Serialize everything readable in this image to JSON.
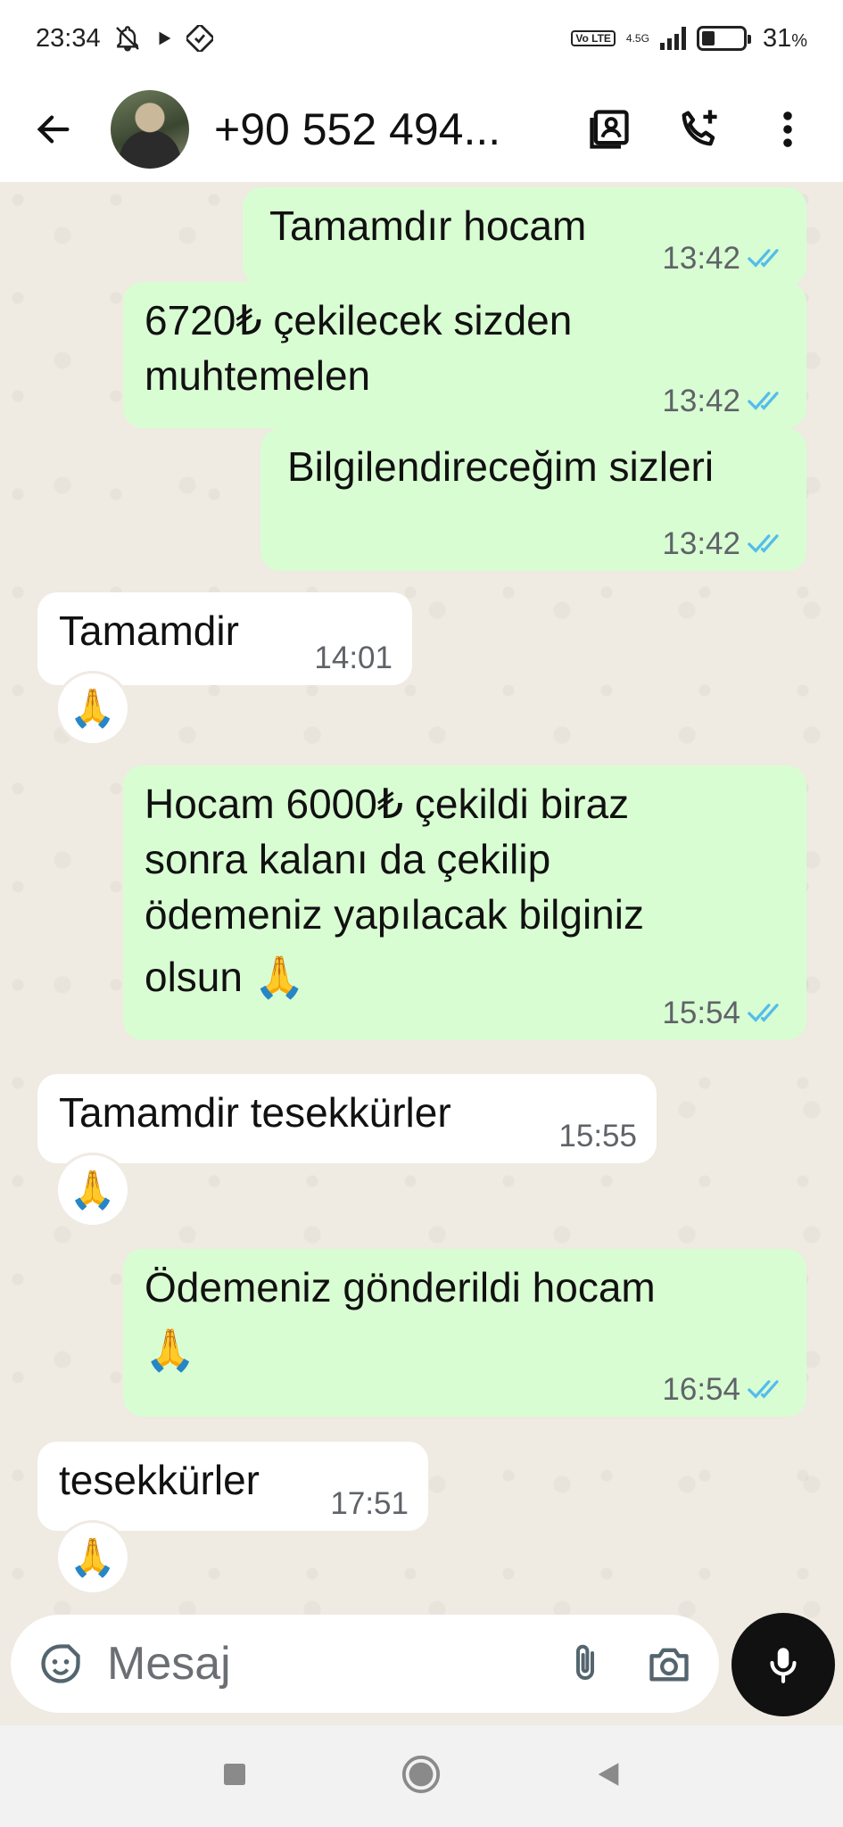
{
  "status_bar": {
    "time": "23:34",
    "network": "4.5G",
    "volte": "Vo LTE",
    "battery": "31",
    "battery_unit": "%",
    "battery_level": 0.31,
    "icons": [
      "bell-off-icon",
      "play-icon",
      "app-icon",
      "signal-icon",
      "battery-icon"
    ]
  },
  "header": {
    "contact_name": "+90 552 494...",
    "icons": [
      "back-arrow-icon",
      "contact-card-icon",
      "call-add-icon",
      "more-vert-icon"
    ]
  },
  "messages": [
    {
      "direction": "outgoing",
      "lines": [
        "Tamamdır hocam"
      ],
      "time": "13:42",
      "status": "read"
    },
    {
      "direction": "outgoing",
      "lines": [
        "6720₺ çekilecek sizden",
        "muhtemelen"
      ],
      "time": "13:42",
      "status": "read"
    },
    {
      "direction": "outgoing",
      "lines": [
        "Bilgilendireceğim sizleri"
      ],
      "time": "13:42",
      "status": "read"
    },
    {
      "direction": "incoming",
      "lines": [
        "Tamamdir"
      ],
      "time": "14:01",
      "reaction": "🙏"
    },
    {
      "direction": "outgoing",
      "lines": [
        "Hocam 6000₺ çekildi biraz",
        "sonra kalanı da çekilip",
        "ödemeniz yapılacak bilginiz",
        "olsun 🙏"
      ],
      "time": "15:54",
      "status": "read"
    },
    {
      "direction": "incoming",
      "lines": [
        "Tamamdir tesekkürler"
      ],
      "time": "15:55",
      "reaction": "🙏"
    },
    {
      "direction": "outgoing",
      "lines": [
        "Ödemeniz gönderildi hocam",
        "🙏"
      ],
      "time": "16:54",
      "status": "read"
    },
    {
      "direction": "incoming",
      "lines": [
        "tesekkürler"
      ],
      "time": "17:51",
      "reaction": "🙏"
    }
  ],
  "composer": {
    "placeholder": "Mesaj",
    "icons": [
      "sticker-icon",
      "attach-icon",
      "camera-icon",
      "mic-icon"
    ]
  },
  "navbar": {
    "icons": [
      "recent-apps-icon",
      "home-icon",
      "back-icon"
    ]
  },
  "colors": {
    "outgoing_bubble": "#d9fdd3",
    "incoming_bubble": "#ffffff",
    "chat_bg": "#efeae2",
    "read_ticks": "#53bdeb"
  }
}
